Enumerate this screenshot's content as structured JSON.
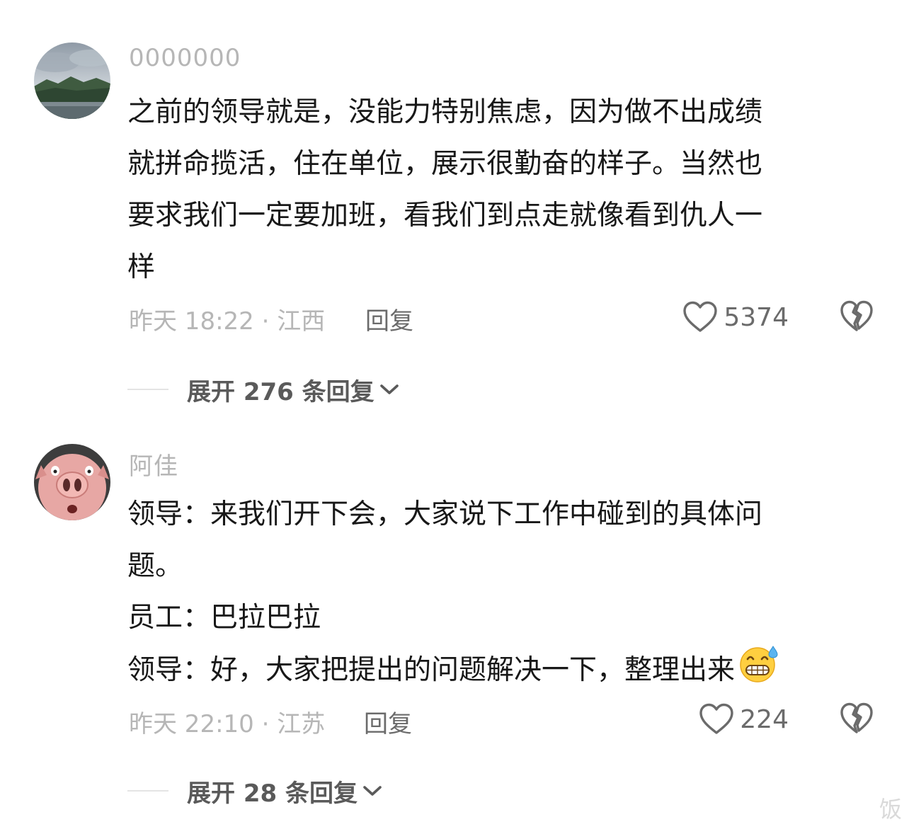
{
  "comments": [
    {
      "username": "0000000",
      "lines": [
        "之前的领导就是，没能力特别焦虑，因为做不出成绩",
        "就拼命揽活，住在单位，展示很勤奋的样子。当然也",
        "要求我们一定要加班，看我们到点走就像看到仇人一",
        "样"
      ],
      "timestamp": "昨天 18:22 · 江西",
      "reply_label": "回复",
      "likes": "5374",
      "expand_label": "展开 276 条回复"
    },
    {
      "username": "阿佳",
      "lines": [
        "领导：来我们开下会，大家说下工作中碰到的具体问",
        "题。",
        "员工：巴拉巴拉",
        "领导：好，大家把提出的问题解决一下，整理出来"
      ],
      "timestamp": "昨天 22:10 · 江苏",
      "reply_label": "回复",
      "likes": "224",
      "expand_label": "展开 28 条回复"
    }
  ],
  "watermark": "饭",
  "icons": {
    "like": "heart-outline-icon",
    "dislike": "broken-heart-icon",
    "expand": "chevron-down-icon",
    "emoji": "grimacing-sweat-emoji"
  },
  "colors": {
    "meta_text": "#b6b6b6",
    "body_text": "#181818",
    "action_text": "#6b6b6b",
    "expand_text": "#5a5a5a"
  }
}
